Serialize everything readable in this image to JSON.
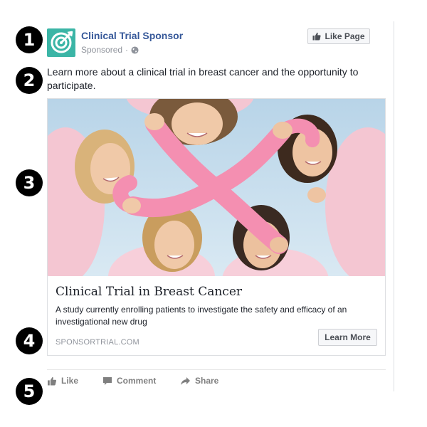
{
  "markers": [
    "1",
    "2",
    "3",
    "4",
    "5"
  ],
  "post": {
    "sponsor_name": "Clinical Trial Sponsor",
    "sponsored_label": "Sponsored",
    "separator": "·",
    "privacy_icon": "globe-icon",
    "like_page_label": "Like Page",
    "text": "Learn more about a clinical trial in breast cancer and the opportunity to participate."
  },
  "card": {
    "image_description": "Group of smiling women in pink holding a pink awareness ribbon",
    "title": "Clinical Trial in Breast Cancer",
    "description": "A study currently enrolling patients to investigate the safety and efficacy of an investigational new drug",
    "domain": "SPONSORTRIAL.COM",
    "cta_label": "Learn More"
  },
  "actions": [
    {
      "label": "Like",
      "icon": "thumbs-up-icon"
    },
    {
      "label": "Comment",
      "icon": "comment-icon"
    },
    {
      "label": "Share",
      "icon": "share-icon"
    }
  ],
  "colors": {
    "brand_blue": "#365899",
    "logo_teal": "#3bb5a6",
    "ribbon_pink": "#f48fb1",
    "marker_black": "#000000"
  }
}
